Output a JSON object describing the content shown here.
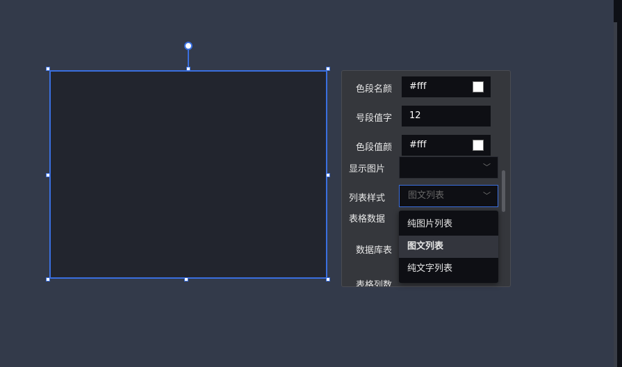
{
  "fields": [
    {
      "label": "色段名颜",
      "value": "#fff",
      "swatch": "#ffffff"
    },
    {
      "label": "号段值字",
      "value": "12"
    },
    {
      "label": "色段值颜",
      "value": "#fff",
      "swatch": "#ffffff"
    }
  ],
  "show_image": {
    "label": "显示图片",
    "value": ""
  },
  "list_style": {
    "label": "列表样式",
    "placeholder": "图文列表",
    "options": [
      "纯图片列表",
      "图文列表",
      "纯文字列表"
    ],
    "selected": "图文列表"
  },
  "table_data": {
    "label": "表格数据"
  },
  "db_table": {
    "label": "数据库表"
  },
  "table_cols": {
    "label": "表格列数"
  }
}
